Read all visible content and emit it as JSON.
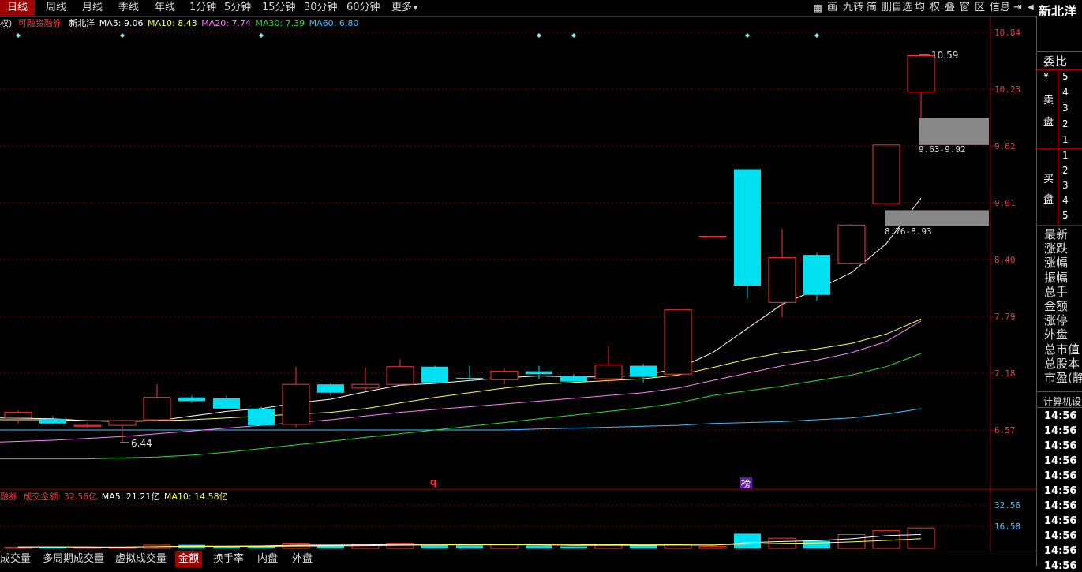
{
  "toolbar": {
    "periods": [
      "日线",
      "周线",
      "月线",
      "季线",
      "年线",
      "1分钟",
      "5分钟",
      "15分钟",
      "30分钟",
      "60分钟",
      "更多"
    ],
    "more_arrow": "▾",
    "tools": [
      "画",
      "九转",
      "简",
      "删自选",
      "均",
      "权",
      "叠",
      "窗",
      "区",
      "信息"
    ],
    "stock_name": "新北洋"
  },
  "info_line": {
    "prefix": "权)",
    "margin_tag": "可融资融券",
    "name": "新北洋",
    "ma5": "MA5: 9.06",
    "ma10": "MA10: 8.43",
    "ma20": "MA20: 7.74",
    "ma30": "MA30: 7.39",
    "ma60": "MA60: 6.80"
  },
  "vol_line": {
    "prefix": "融券",
    "label": "成交金额: 32.56亿",
    "ma5": "MA5: 21.21亿",
    "ma10": "MA10: 14.58亿"
  },
  "annotations": {
    "high": "10.59",
    "low": "6.44",
    "zone_upper": "9.63-9.92",
    "zone_lower": "8.76-8.93",
    "marker_q": "q",
    "marker_bang": "榜"
  },
  "bottom_tabs": [
    "成交量",
    "多周期成交量",
    "虚拟成交量",
    "金额",
    "换手率",
    "内盘",
    "外盘"
  ],
  "right_panel": {
    "weibi": "委比",
    "sell_labels": [
      "卖",
      "盘"
    ],
    "buy_labels": [
      "买",
      "盘"
    ],
    "yen": "¥",
    "sell_levels": [
      "5",
      "4",
      "3",
      "2",
      "1"
    ],
    "buy_levels": [
      "1",
      "2",
      "3",
      "4",
      "5"
    ],
    "fields": [
      "最新",
      "涨跌",
      "涨幅",
      "振幅",
      "总手",
      "金额",
      "涨停",
      "外盘",
      "总市值",
      "总股本",
      "市盈(静)"
    ],
    "calc_label": "计算机设",
    "times": [
      "14:56",
      "14:56",
      "14:56",
      "14:56",
      "14:56",
      "14:56",
      "14:56",
      "14:56",
      "14:56",
      "14:56",
      "14:56"
    ]
  },
  "chart_data": {
    "type": "candlestick",
    "price_axis": [
      "10.84",
      "10.23",
      "9.62",
      "9.01",
      "8.40",
      "7.79",
      "7.18",
      "6.57"
    ],
    "price_ticks": [
      10.84,
      10.23,
      9.62,
      9.01,
      8.4,
      7.79,
      7.18,
      6.57
    ],
    "volume_axis": [
      "32.56",
      "16.58"
    ],
    "volume_ticks": [
      32.56,
      16.58
    ],
    "ylim": [
      6.1,
      11.0
    ],
    "candles": [
      {
        "o": 6.7,
        "h": 6.78,
        "l": 6.64,
        "c": 6.76
      },
      {
        "o": 6.69,
        "h": 6.72,
        "l": 6.63,
        "c": 6.64
      },
      {
        "o": 6.61,
        "h": 6.65,
        "l": 6.59,
        "c": 6.62
      },
      {
        "o": 6.62,
        "h": 6.68,
        "l": 6.44,
        "c": 6.67
      },
      {
        "o": 6.68,
        "h": 7.06,
        "l": 6.67,
        "c": 6.92
      },
      {
        "o": 6.92,
        "h": 6.94,
        "l": 6.86,
        "c": 6.88
      },
      {
        "o": 6.91,
        "h": 6.94,
        "l": 6.8,
        "c": 6.8
      },
      {
        "o": 6.8,
        "h": 6.82,
        "l": 6.62,
        "c": 6.62
      },
      {
        "o": 6.63,
        "h": 7.25,
        "l": 6.6,
        "c": 7.06
      },
      {
        "o": 7.06,
        "h": 7.08,
        "l": 6.94,
        "c": 6.97
      },
      {
        "o": 7.02,
        "h": 7.24,
        "l": 6.98,
        "c": 7.06
      },
      {
        "o": 7.06,
        "h": 7.33,
        "l": 7.05,
        "c": 7.25
      },
      {
        "o": 7.25,
        "h": 7.26,
        "l": 7.1,
        "c": 7.08
      },
      {
        "o": 7.13,
        "h": 7.26,
        "l": 7.1,
        "c": 7.12
      },
      {
        "o": 7.11,
        "h": 7.23,
        "l": 7.06,
        "c": 7.2
      },
      {
        "o": 7.2,
        "h": 7.26,
        "l": 7.12,
        "c": 7.17
      },
      {
        "o": 7.15,
        "h": 7.17,
        "l": 7.07,
        "c": 7.09
      },
      {
        "o": 7.12,
        "h": 7.47,
        "l": 7.08,
        "c": 7.27
      },
      {
        "o": 7.26,
        "h": 7.28,
        "l": 7.08,
        "c": 7.14
      },
      {
        "o": 7.17,
        "h": 7.85,
        "l": 7.16,
        "c": 7.86
      },
      {
        "o": 8.65,
        "h": 8.65,
        "l": 8.65,
        "c": 8.65
      },
      {
        "o": 9.37,
        "h": 9.37,
        "l": 7.98,
        "c": 8.12
      },
      {
        "o": 7.94,
        "h": 8.73,
        "l": 7.78,
        "c": 8.42
      },
      {
        "o": 8.45,
        "h": 8.47,
        "l": 7.96,
        "c": 8.02
      },
      {
        "o": 8.36,
        "h": 8.78,
        "l": 8.35,
        "c": 8.77
      },
      {
        "o": 9.0,
        "h": 9.63,
        "l": 8.99,
        "c": 9.63
      },
      {
        "o": 10.2,
        "h": 10.59,
        "l": 9.9,
        "c": 10.59
      }
    ],
    "ma5": [
      6.7,
      6.69,
      6.67,
      6.66,
      6.67,
      6.72,
      6.77,
      6.8,
      6.86,
      6.9,
      6.98,
      7.05,
      7.07,
      7.1,
      7.13,
      7.15,
      7.14,
      7.14,
      7.16,
      7.23,
      7.4,
      7.66,
      7.92,
      8.08,
      8.26,
      8.57,
      9.06
    ],
    "ma10": [
      6.68,
      6.68,
      6.67,
      6.67,
      6.67,
      6.68,
      6.7,
      6.72,
      6.74,
      6.76,
      6.8,
      6.86,
      6.92,
      6.97,
      7.02,
      7.06,
      7.08,
      7.1,
      7.12,
      7.16,
      7.24,
      7.33,
      7.4,
      7.44,
      7.5,
      7.6,
      7.76,
      7.94,
      8.18,
      8.43
    ],
    "ma20": [
      6.44,
      6.46,
      6.48,
      6.5,
      6.53,
      6.56,
      6.59,
      6.62,
      6.65,
      6.68,
      6.72,
      6.76,
      6.79,
      6.82,
      6.85,
      6.88,
      6.91,
      6.94,
      6.97,
      7.02,
      7.1,
      7.18,
      7.26,
      7.32,
      7.4,
      7.52,
      7.74
    ],
    "ma30": [
      6.26,
      6.26,
      6.26,
      6.27,
      6.28,
      6.3,
      6.33,
      6.37,
      6.41,
      6.45,
      6.49,
      6.53,
      6.57,
      6.61,
      6.65,
      6.69,
      6.73,
      6.77,
      6.81,
      6.86,
      6.94,
      6.99,
      7.04,
      7.1,
      7.16,
      7.25,
      7.39
    ],
    "ma60": [
      6.57,
      6.57,
      6.57,
      6.57,
      6.57,
      6.57,
      6.57,
      6.57,
      6.57,
      6.57,
      6.57,
      6.57,
      6.57,
      6.57,
      6.57,
      6.58,
      6.59,
      6.6,
      6.61,
      6.62,
      6.64,
      6.65,
      6.66,
      6.68,
      6.7,
      6.74,
      6.8
    ],
    "volumes": [
      1.0,
      1.2,
      0.9,
      0.8,
      2.4,
      2.6,
      1.4,
      1.6,
      3.8,
      2.6,
      3.0,
      3.8,
      2.6,
      2.2,
      2.6,
      2.2,
      1.5,
      3.0,
      2.3,
      3.2,
      1.4,
      11.0,
      7.6,
      5.5,
      10.4,
      13.2,
      15.3
    ]
  }
}
